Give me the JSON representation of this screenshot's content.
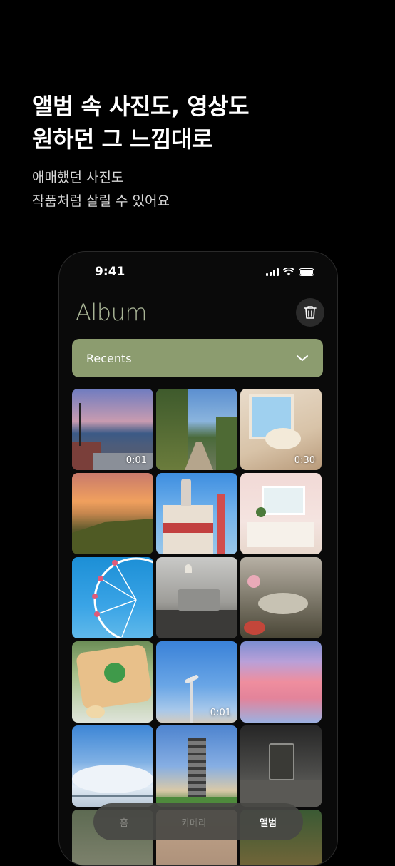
{
  "headline": [
    "앨범 속 사진도, 영상도",
    "원하던 그 느낌대로"
  ],
  "subline": [
    "애매했던 사진도",
    "작품처럼 살릴 수 있어요"
  ],
  "status": {
    "time": "9:41"
  },
  "album": {
    "title": "Album",
    "dropdown_label": "Recents",
    "accent": "#8c9c6f"
  },
  "grid": [
    {
      "subject": "beach street dusk",
      "duration": "0:01"
    },
    {
      "subject": "tree-lined path",
      "duration": ""
    },
    {
      "subject": "window shell still life",
      "duration": "0:30"
    },
    {
      "subject": "sunset over hills",
      "duration": ""
    },
    {
      "subject": "retro building",
      "duration": ""
    },
    {
      "subject": "pink kitchen",
      "duration": ""
    },
    {
      "subject": "ferris wheel",
      "duration": ""
    },
    {
      "subject": "grey interior",
      "duration": ""
    },
    {
      "subject": "dessert table",
      "duration": ""
    },
    {
      "subject": "toast with clover",
      "duration": ""
    },
    {
      "subject": "street lamp sky",
      "duration": "0:01"
    },
    {
      "subject": "pink clouds",
      "duration": ""
    },
    {
      "subject": "blue sky clouds",
      "duration": ""
    },
    {
      "subject": "observation tower",
      "duration": ""
    },
    {
      "subject": "iced coffee glass",
      "duration": ""
    },
    {
      "subject": "partial row",
      "duration": ""
    },
    {
      "subject": "partial row",
      "duration": ""
    },
    {
      "subject": "partial row",
      "duration": ""
    }
  ],
  "tabs": [
    {
      "label": "홈",
      "active": false
    },
    {
      "label": "카메라",
      "active": false
    },
    {
      "label": "앨범",
      "active": true
    }
  ]
}
